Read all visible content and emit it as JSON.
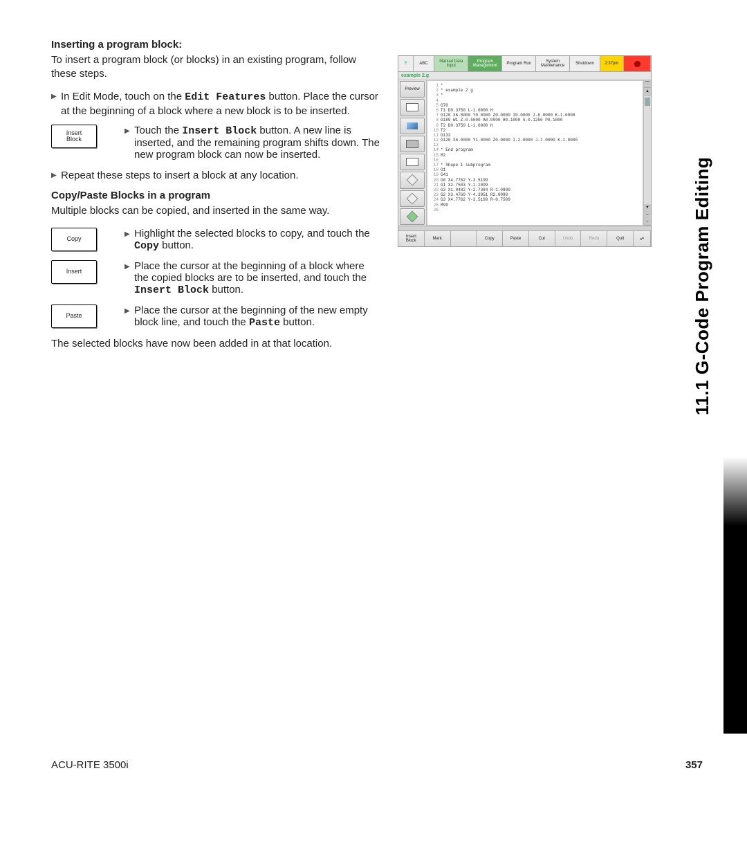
{
  "section_side_title": "11.1 G-Code Program Editing",
  "heading1": "Inserting a program block:",
  "para1": "To insert a program block (or blocks) in an existing program, follow these steps.",
  "bullet1_pre": "In Edit Mode, touch on the ",
  "bullet1_mono": "Edit Features",
  "bullet1_post": " button. Place the cursor at the beginning of a  block where a new block is to be  inserted.",
  "key_insert_block": "Insert\nBlock",
  "row1_pre": "Touch the ",
  "row1_mono": "Insert Block",
  "row1_post": " button. A new line is inserted, and the remaining program shifts down.  The new program block can now be inserted.",
  "bullet2": "Repeat these steps to insert a block at any location.",
  "heading2": "Copy/Paste Blocks in a program",
  "para2": "Multiple blocks can be copied, and inserted in the same way.",
  "key_copy": "Copy",
  "row_copy_pre": "Highlight the selected blocks to copy, and touch the ",
  "row_copy_mono": "Copy",
  "row_copy_post": " button.",
  "key_insert": "Insert",
  "row_ins_pre": "Place the cursor at the beginning of a  block where the copied blocks are to be inserted, and touch the ",
  "row_ins_mono": "Insert Block",
  "row_ins_post": " button.",
  "key_paste": "Paste",
  "row_paste_pre": "Place the cursor at the beginning of the new empty block line, and touch the ",
  "row_paste_mono": "Paste",
  "row_paste_post": " button.",
  "closing": "The selected blocks have now been added in at that location.",
  "footer_model": "ACU-RITE 3500i",
  "page_number": "357",
  "shot": {
    "menus": {
      "help": "?",
      "abc": "ABC",
      "mdi": "Manual Data\nInput",
      "pm": "Program\nManagement",
      "run": "Program Run",
      "sys": "System\nMaintenance",
      "shutdown": "Shutdown",
      "time": "2:37pm"
    },
    "program_title": "example 2.g",
    "side": {
      "preview": "Preview"
    },
    "code_lines": [
      "1 *",
      "2 * example 2 g",
      "3 *",
      "4",
      "5 G70",
      "6 T1 D0.3750 L-1.0000 H",
      "7 G120 X6.0000 Y0.0000 Z0.0000 I0.0000 J-6.0000 K-1.0008",
      "8 G189 W1 Z-0.5000 A0.0900 H0.1000 S-0.1250 P0.1000",
      "9 T2 D0.3750 L-1.0000 H",
      "10 T2",
      "11 G133",
      "12 G120 X6.0000 Y1.0000 Z0.0000 I-2.0000 J-7.0000 K-1.0000",
      "13",
      "14 * End program",
      "15 M2",
      "16",
      "17 * Shape 1 subprogram",
      "18 O1",
      "19 G41",
      "20 G0 X4.7762 Y-3.5199",
      "21 G1 X2.7503 Y-1.1099",
      "22 G3 X1.0482 Y-2.7384 R-1.0800",
      "23 G2 X3.4760 Y-4.3951 R2.0080",
      "24 G3 X4.7762 Y-3.5199 R-0.7509",
      "25 M99",
      "26"
    ],
    "footer_buttons": {
      "insert_block": "Insert\nBlock",
      "mark": "Mark",
      "blank": "",
      "copy": "Copy",
      "paste": "Paste",
      "cut": "Cut",
      "undo": "Undo",
      "redo": "Redo",
      "quit": "Quit"
    }
  }
}
